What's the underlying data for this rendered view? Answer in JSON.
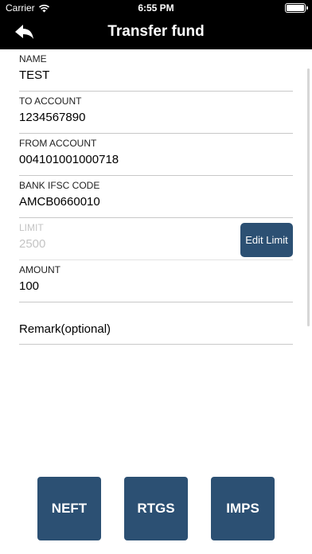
{
  "status": {
    "carrier": "Carrier",
    "time": "6:55 PM"
  },
  "header": {
    "title": "Transfer fund"
  },
  "form": {
    "name": {
      "label": "NAME",
      "value": "TEST"
    },
    "to_account": {
      "label": "TO ACCOUNT",
      "value": "1234567890"
    },
    "from_account": {
      "label": "FROM ACCOUNT",
      "value": "004101001000718"
    },
    "ifsc": {
      "label": "BANK IFSC CODE",
      "value": "AMCB0660010"
    },
    "limit": {
      "label": "LIMIT",
      "value": "2500"
    },
    "edit_limit_label": "Edit Limit",
    "amount": {
      "label": "AMOUNT",
      "value": "100"
    },
    "remark": {
      "placeholder": "Remark(optional)"
    }
  },
  "actions": {
    "neft": "NEFT",
    "rtgs": "RTGS",
    "imps": "IMPS"
  },
  "colors": {
    "accent": "#2c5073",
    "header_bg": "#000000"
  }
}
